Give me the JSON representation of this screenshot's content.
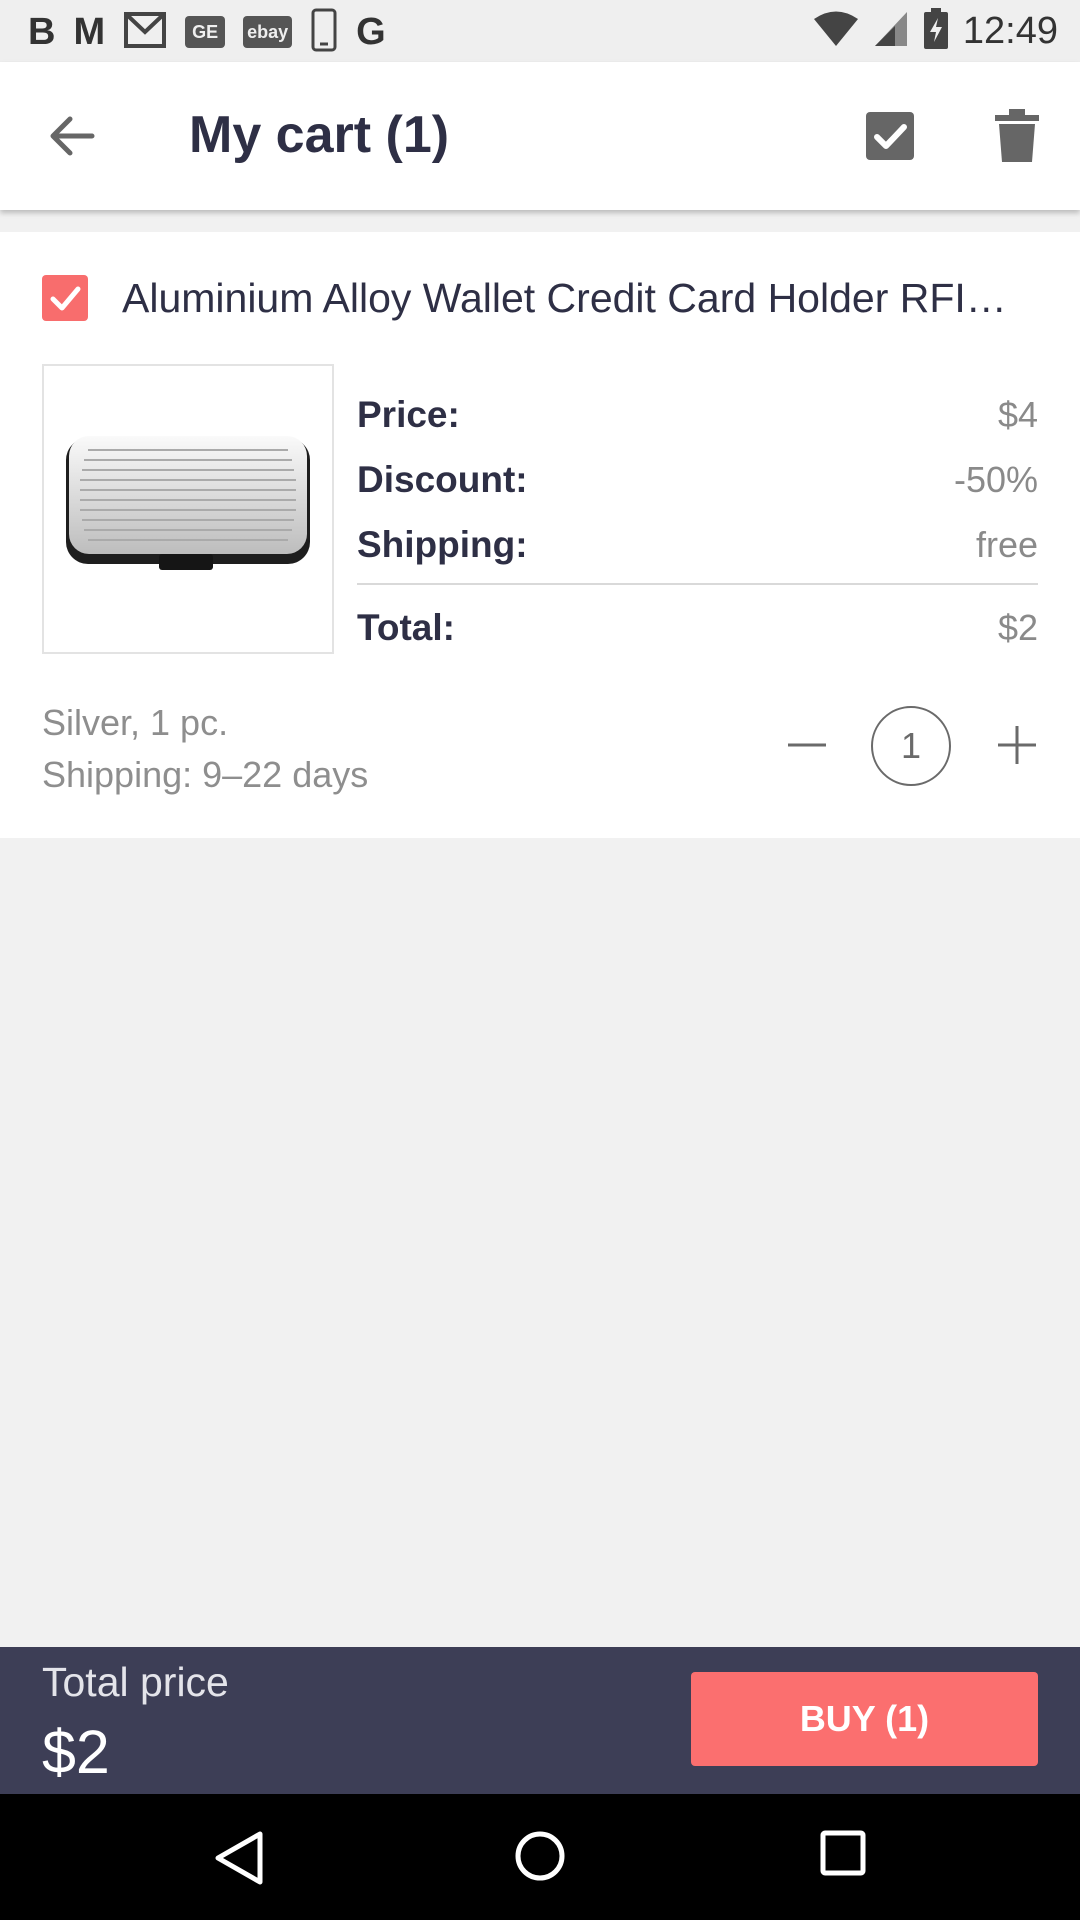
{
  "status_bar": {
    "time": "12:49",
    "left_icons": [
      "b-app-icon",
      "m-app-icon",
      "gmail-icon",
      "ge-app-icon",
      "ebay-icon",
      "phone-icon",
      "google-icon"
    ],
    "ge_badge": "GE",
    "ebay_badge": "ebay",
    "b_letter": "B",
    "m_letter": "M",
    "g_letter": "G"
  },
  "app_bar": {
    "title": "My cart (1)",
    "icons": [
      "back-arrow-icon",
      "check-all-icon",
      "trash-icon"
    ]
  },
  "cart_item": {
    "title": "Aluminium Alloy Wallet Credit Card Holder RFID…",
    "checked": true,
    "price_rows": [
      {
        "label": "Price:",
        "value": "$4"
      },
      {
        "label": "Discount:",
        "value": "-50%"
      },
      {
        "label": "Shipping:",
        "value": "free"
      }
    ],
    "total": {
      "label": "Total:",
      "value": "$2"
    },
    "variant": "Silver, 1 pc.",
    "shipping_time": "Shipping: 9–22 days",
    "quantity": "1"
  },
  "bottom_bar": {
    "total_label": "Total price",
    "total_value": "$2",
    "buy_label": "BUY (1)"
  },
  "colors": {
    "accent": "#fb6f6f",
    "bottom_bar": "#3d3e56",
    "title_text": "#2e2f45"
  }
}
